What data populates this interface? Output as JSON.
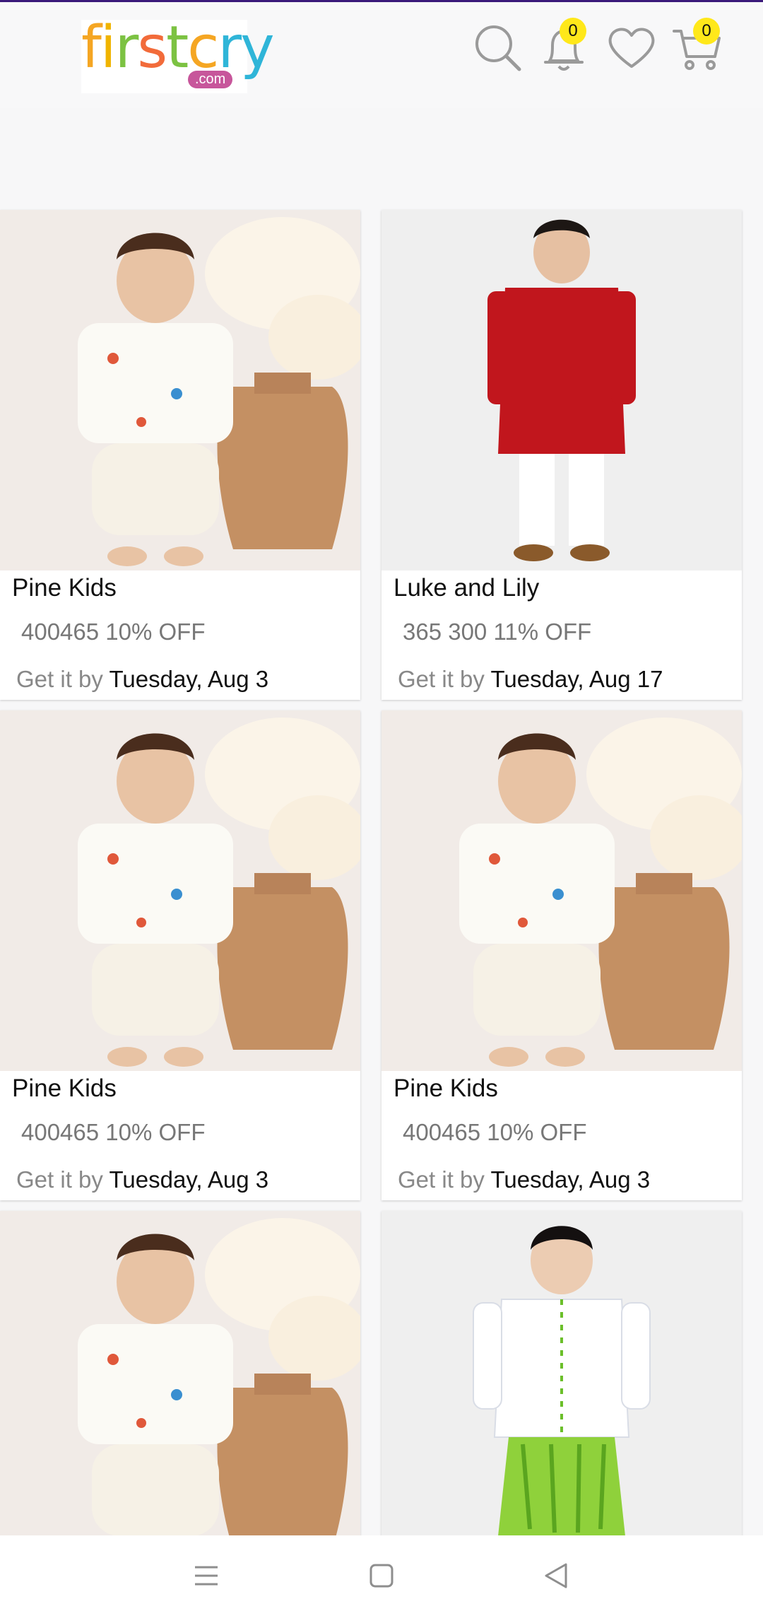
{
  "header": {
    "logo_text": "firstcry",
    "logo_sub": ".com",
    "notification_count": "0",
    "cart_count": "0",
    "icons": [
      "search-icon",
      "bell-icon",
      "heart-icon",
      "cart-icon"
    ]
  },
  "products": [
    {
      "brand": "Pine Kids",
      "price": "400465 10% OFF",
      "delivery_label": "Get it by",
      "delivery_date": "Tuesday, Aug 3",
      "image": "boy-cream-jacket-dhoti-vase"
    },
    {
      "brand": "Luke and Lily",
      "price": "365 300 11% OFF",
      "delivery_label": "Get it by",
      "delivery_date": "Tuesday, Aug 17",
      "image": "boy-red-kurta"
    },
    {
      "brand": "Pine Kids",
      "price": "400465 10% OFF",
      "delivery_label": "Get it by",
      "delivery_date": "Tuesday, Aug 3",
      "image": "boy-cream-jacket-dhoti-vase"
    },
    {
      "brand": "Pine Kids",
      "price": "400465 10% OFF",
      "delivery_label": "Get it by",
      "delivery_date": "Tuesday, Aug 3",
      "image": "boy-cream-jacket-dhoti-vase"
    },
    {
      "brand": "",
      "price": "",
      "delivery_label": "",
      "delivery_date": "",
      "image": "boy-cream-jacket-dhoti-vase"
    },
    {
      "brand": "",
      "price": "",
      "delivery_label": "",
      "delivery_date": "",
      "image": "boy-white-kurta-green-dhoti"
    }
  ],
  "navbar": {
    "icons": [
      "menu-icon",
      "home-square-icon",
      "back-triangle-icon"
    ]
  },
  "colors": {
    "accent_top": "#3b1a7a",
    "badge": "#ffe81a",
    "logo_badge": "#c7569b"
  }
}
